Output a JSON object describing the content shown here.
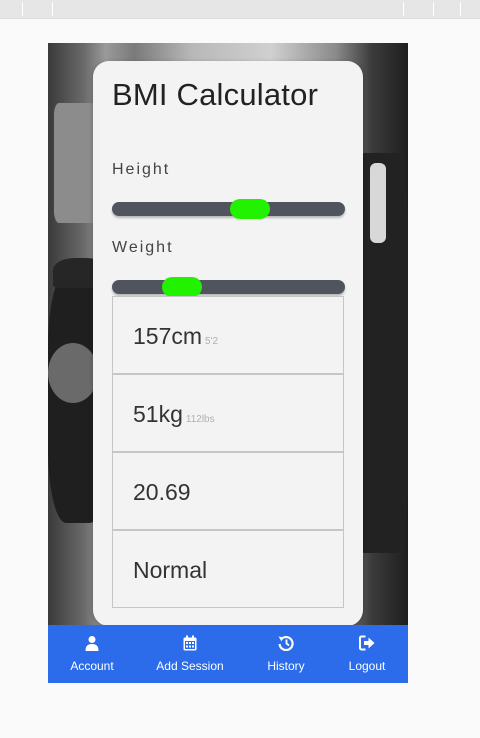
{
  "app": {
    "title": "BMI Calculator"
  },
  "height": {
    "label": "Height",
    "slider_fraction": 0.61,
    "value": "157cm",
    "imperial": "5'2"
  },
  "weight": {
    "label": "Weight",
    "slider_fraction": 0.26,
    "value": "51kg",
    "imperial": "112lbs"
  },
  "bmi": {
    "value": "20.69",
    "category": "Normal"
  },
  "nav": {
    "items": [
      {
        "label": "Account",
        "icon": "user-icon"
      },
      {
        "label": "Add Session",
        "icon": "calendar-icon"
      },
      {
        "label": "History",
        "icon": "history-icon"
      },
      {
        "label": "Logout",
        "icon": "logout-icon"
      }
    ]
  },
  "colors": {
    "accent": "#22f200",
    "nav_bar": "#2c6bea",
    "track": "#4f545e"
  }
}
